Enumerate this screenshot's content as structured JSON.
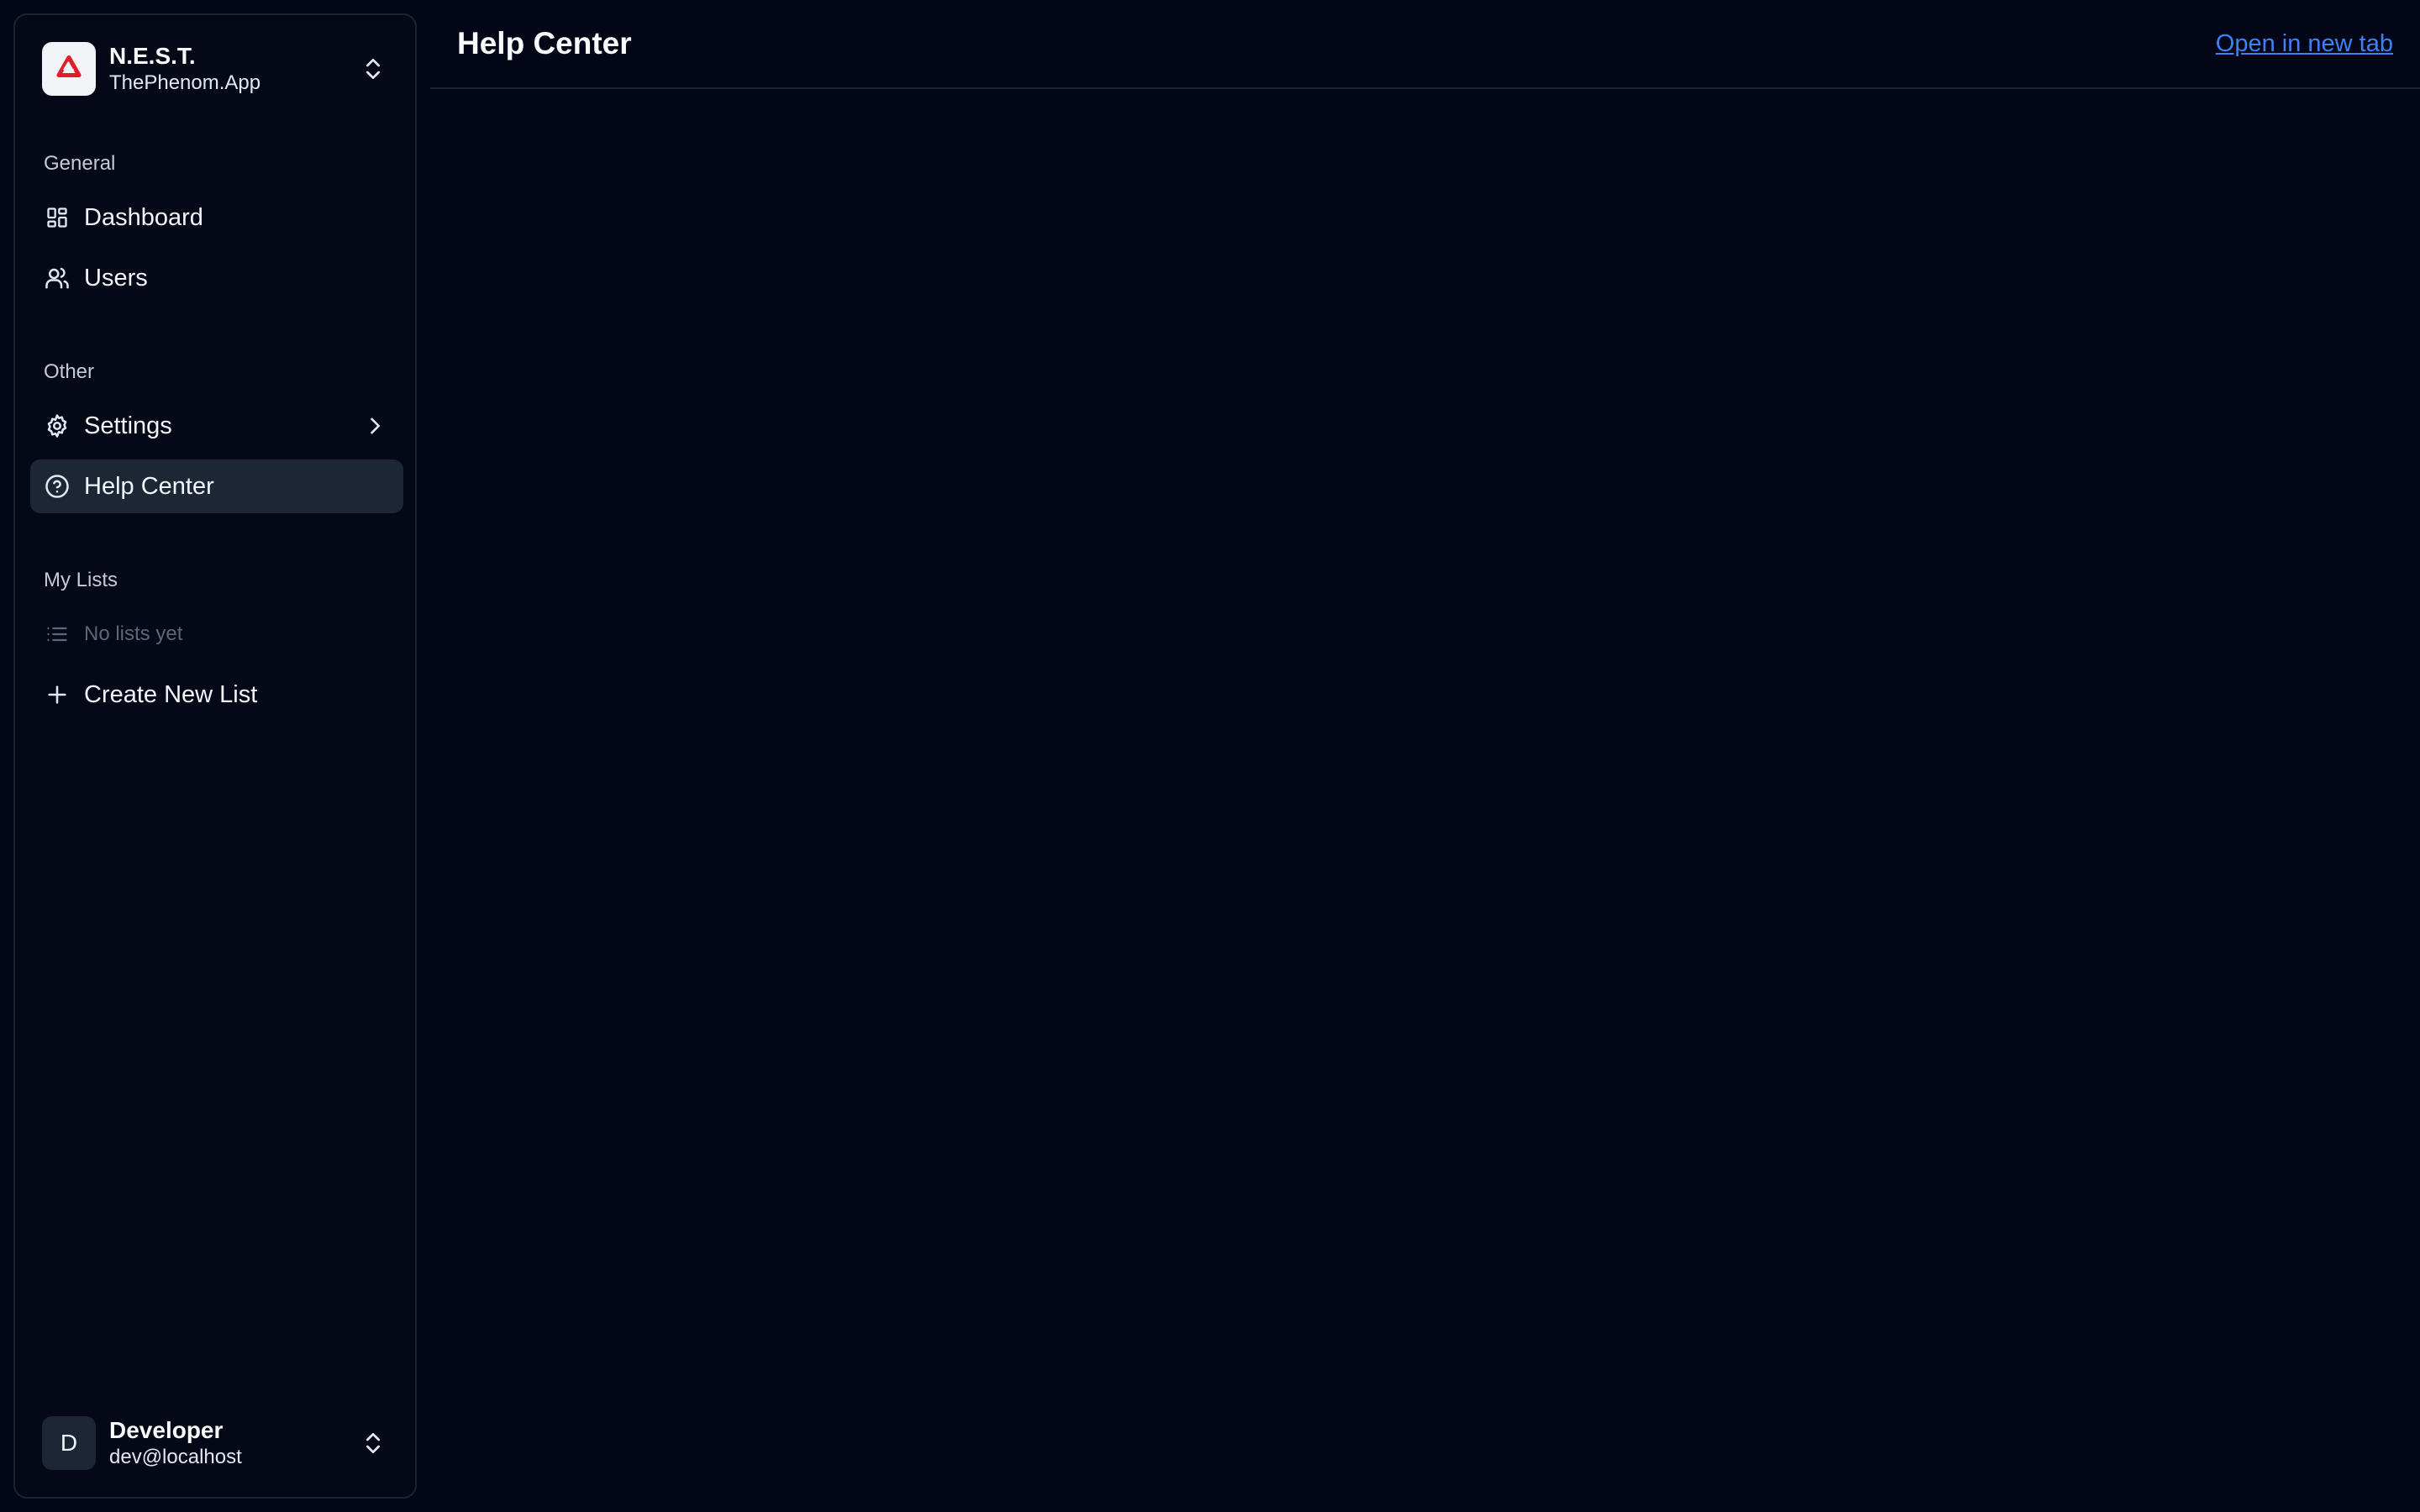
{
  "brand": {
    "name": "N.E.S.T.",
    "subtitle": "ThePhenom.App",
    "logo_color": "#e11d2a"
  },
  "sidebar": {
    "sections": [
      {
        "label": "General",
        "items": [
          {
            "label": "Dashboard",
            "icon": "dashboard-icon"
          },
          {
            "label": "Users",
            "icon": "users-icon"
          }
        ]
      },
      {
        "label": "Other",
        "items": [
          {
            "label": "Settings",
            "icon": "gear-icon",
            "has_submenu": true
          },
          {
            "label": "Help Center",
            "icon": "help-circle-icon",
            "active": true
          }
        ]
      },
      {
        "label": "My Lists",
        "items": [
          {
            "label": "No lists yet",
            "icon": "list-icon",
            "disabled": true
          },
          {
            "label": "Create New List",
            "icon": "plus-icon"
          }
        ]
      }
    ]
  },
  "user": {
    "initial": "D",
    "name": "Developer",
    "email": "dev@localhost"
  },
  "header": {
    "title": "Help Center",
    "open_link": "Open in new tab"
  },
  "colors": {
    "background": "#030617",
    "border": "#1c2434",
    "active_item": "#1d2634",
    "link": "#3b82f6"
  }
}
